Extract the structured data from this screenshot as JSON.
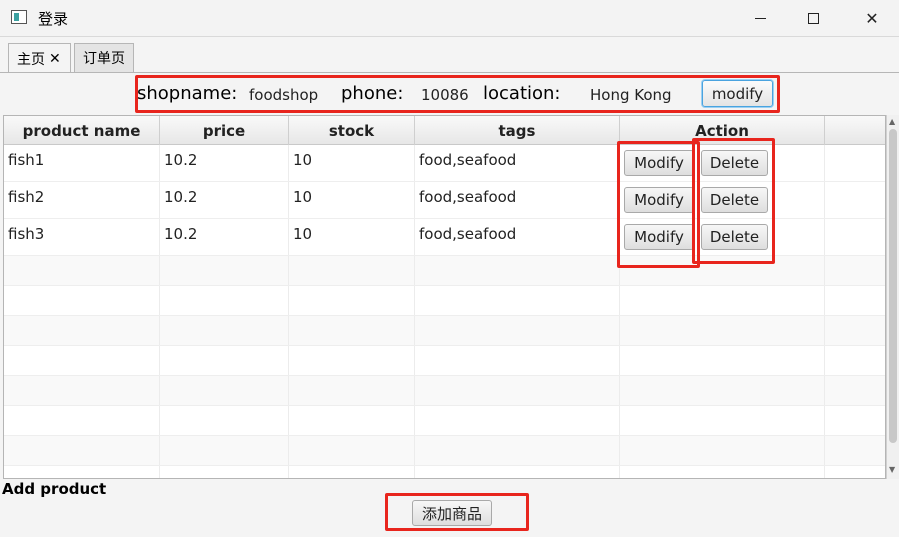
{
  "window": {
    "title": "登录",
    "minimize_symbol": "minimize-icon",
    "maximize_symbol": "maximize-icon",
    "close_symbol": "✕"
  },
  "tabs": [
    {
      "label": "主页",
      "close": "✕",
      "active": true
    },
    {
      "label": "订单页",
      "active": false
    }
  ],
  "shop_info": {
    "shopname_label": "shopname:",
    "shopname_value": "foodshop",
    "phone_label": "phone:",
    "phone_value": "10086",
    "location_label": "location:",
    "location_value": "Hong Kong",
    "modify_label": "modify"
  },
  "table": {
    "columns": [
      "product name",
      "price",
      "stock",
      "tags",
      "Action"
    ],
    "rows": [
      {
        "name": "fish1",
        "price": "10.2",
        "stock": "10",
        "tags": "food,seafood",
        "modify": "Modify",
        "delete": "Delete"
      },
      {
        "name": "fish2",
        "price": "10.2",
        "stock": "10",
        "tags": "food,seafood",
        "modify": "Modify",
        "delete": "Delete"
      },
      {
        "name": "fish3",
        "price": "10.2",
        "stock": "10",
        "tags": "food,seafood",
        "modify": "Modify",
        "delete": "Delete"
      }
    ]
  },
  "add_product": {
    "heading": "Add product",
    "button_label": "添加商品"
  },
  "colors": {
    "highlight": "#e8251d",
    "focus": "#4aa3df"
  }
}
